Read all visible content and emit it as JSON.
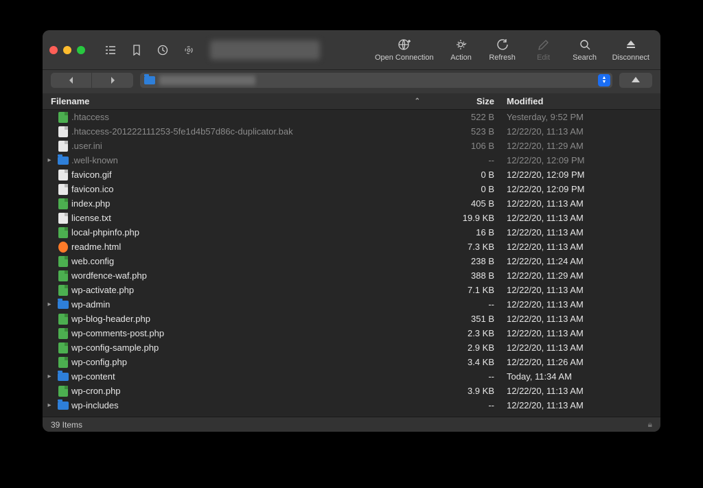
{
  "toolbar": {
    "open_connection": "Open Connection",
    "action": "Action",
    "refresh": "Refresh",
    "edit": "Edit",
    "search": "Search",
    "disconnect": "Disconnect"
  },
  "columns": {
    "filename": "Filename",
    "size": "Size",
    "modified": "Modified"
  },
  "files": [
    {
      "name": ".htaccess",
      "size": "522 B",
      "modified": "Yesterday, 9:52 PM",
      "type": "php",
      "dim": true
    },
    {
      "name": ".htaccess-201222111253-5fe1d4b57d86c-duplicator.bak",
      "size": "523 B",
      "modified": "12/22/20, 11:13 AM",
      "type": "white",
      "dim": true
    },
    {
      "name": ".user.ini",
      "size": "106 B",
      "modified": "12/22/20, 11:29 AM",
      "type": "white",
      "dim": true
    },
    {
      "name": ".well-known",
      "size": "--",
      "modified": "12/22/20, 12:09 PM",
      "type": "folder",
      "dim": true,
      "expandable": true
    },
    {
      "name": "favicon.gif",
      "size": "0 B",
      "modified": "12/22/20, 12:09 PM",
      "type": "white"
    },
    {
      "name": "favicon.ico",
      "size": "0 B",
      "modified": "12/22/20, 12:09 PM",
      "type": "white"
    },
    {
      "name": "index.php",
      "size": "405 B",
      "modified": "12/22/20, 11:13 AM",
      "type": "php"
    },
    {
      "name": "license.txt",
      "size": "19.9 KB",
      "modified": "12/22/20, 11:13 AM",
      "type": "white"
    },
    {
      "name": "local-phpinfo.php",
      "size": "16 B",
      "modified": "12/22/20, 11:13 AM",
      "type": "php"
    },
    {
      "name": "readme.html",
      "size": "7.3 KB",
      "modified": "12/22/20, 11:13 AM",
      "type": "ff"
    },
    {
      "name": "web.config",
      "size": "238 B",
      "modified": "12/22/20, 11:24 AM",
      "type": "php"
    },
    {
      "name": "wordfence-waf.php",
      "size": "388 B",
      "modified": "12/22/20, 11:29 AM",
      "type": "php"
    },
    {
      "name": "wp-activate.php",
      "size": "7.1 KB",
      "modified": "12/22/20, 11:13 AM",
      "type": "php"
    },
    {
      "name": "wp-admin",
      "size": "--",
      "modified": "12/22/20, 11:13 AM",
      "type": "folder",
      "expandable": true
    },
    {
      "name": "wp-blog-header.php",
      "size": "351 B",
      "modified": "12/22/20, 11:13 AM",
      "type": "php"
    },
    {
      "name": "wp-comments-post.php",
      "size": "2.3 KB",
      "modified": "12/22/20, 11:13 AM",
      "type": "php"
    },
    {
      "name": "wp-config-sample.php",
      "size": "2.9 KB",
      "modified": "12/22/20, 11:13 AM",
      "type": "php"
    },
    {
      "name": "wp-config.php",
      "size": "3.4 KB",
      "modified": "12/22/20, 11:26 AM",
      "type": "php"
    },
    {
      "name": "wp-content",
      "size": "--",
      "modified": "Today, 11:34 AM",
      "type": "folder",
      "expandable": true
    },
    {
      "name": "wp-cron.php",
      "size": "3.9 KB",
      "modified": "12/22/20, 11:13 AM",
      "type": "php"
    },
    {
      "name": "wp-includes",
      "size": "--",
      "modified": "12/22/20, 11:13 AM",
      "type": "folder",
      "expandable": true
    }
  ],
  "status": {
    "count": "39 Items"
  }
}
